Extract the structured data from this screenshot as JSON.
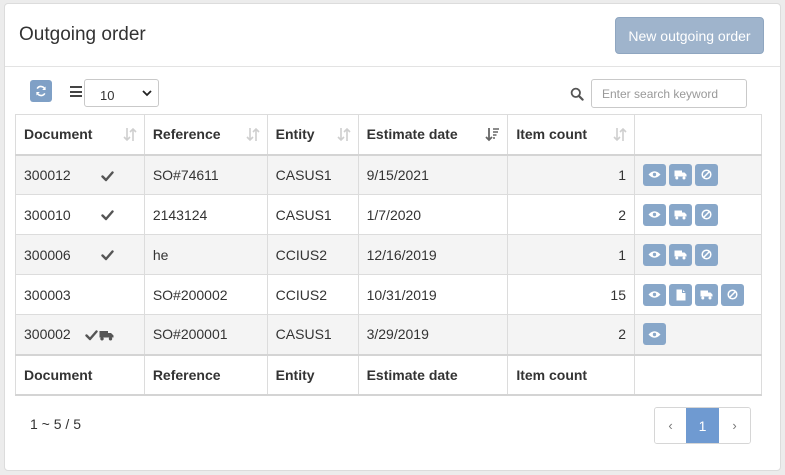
{
  "header": {
    "title": "Outgoing order",
    "new_button_label": "New outgoing order"
  },
  "toolbar": {
    "page_size": "10",
    "search_placeholder": "Enter search keyword",
    "icons": {
      "refresh": "refresh-icon",
      "list": "list-icon",
      "search": "search-icon"
    }
  },
  "table": {
    "columns": [
      "Document",
      "Reference",
      "Entity",
      "Estimate date",
      "Item count"
    ],
    "rows": [
      {
        "document": "300012",
        "status": [
          "check"
        ],
        "reference": "SO#74611",
        "entity": "CASUS1",
        "estimate_date": "9/15/2021",
        "item_count": "1",
        "actions": [
          "view",
          "ship",
          "cancel"
        ]
      },
      {
        "document": "300010",
        "status": [
          "check"
        ],
        "reference": "2143124",
        "entity": "CASUS1",
        "estimate_date": "1/7/2020",
        "item_count": "2",
        "actions": [
          "view",
          "ship",
          "cancel"
        ]
      },
      {
        "document": "300006",
        "status": [
          "check"
        ],
        "reference": "he",
        "entity": "CCIUS2",
        "estimate_date": "12/16/2019",
        "item_count": "1",
        "actions": [
          "view",
          "ship",
          "cancel"
        ]
      },
      {
        "document": "300003",
        "status": [],
        "reference": "SO#200002",
        "entity": "CCIUS2",
        "estimate_date": "10/31/2019",
        "item_count": "15",
        "actions": [
          "view",
          "copy",
          "ship",
          "cancel"
        ]
      },
      {
        "document": "300002",
        "status": [
          "check",
          "truck"
        ],
        "reference": "SO#200001",
        "entity": "CASUS1",
        "estimate_date": "3/29/2019",
        "item_count": "2",
        "actions": [
          "view"
        ]
      }
    ]
  },
  "pagination": {
    "info": "1 ~ 5 / 5",
    "prev": "‹",
    "current": "1",
    "next": "›"
  },
  "colors": {
    "primary": "#6f9ad1",
    "action_button": "#88a7c9",
    "new_button": "#9fb4cc"
  }
}
